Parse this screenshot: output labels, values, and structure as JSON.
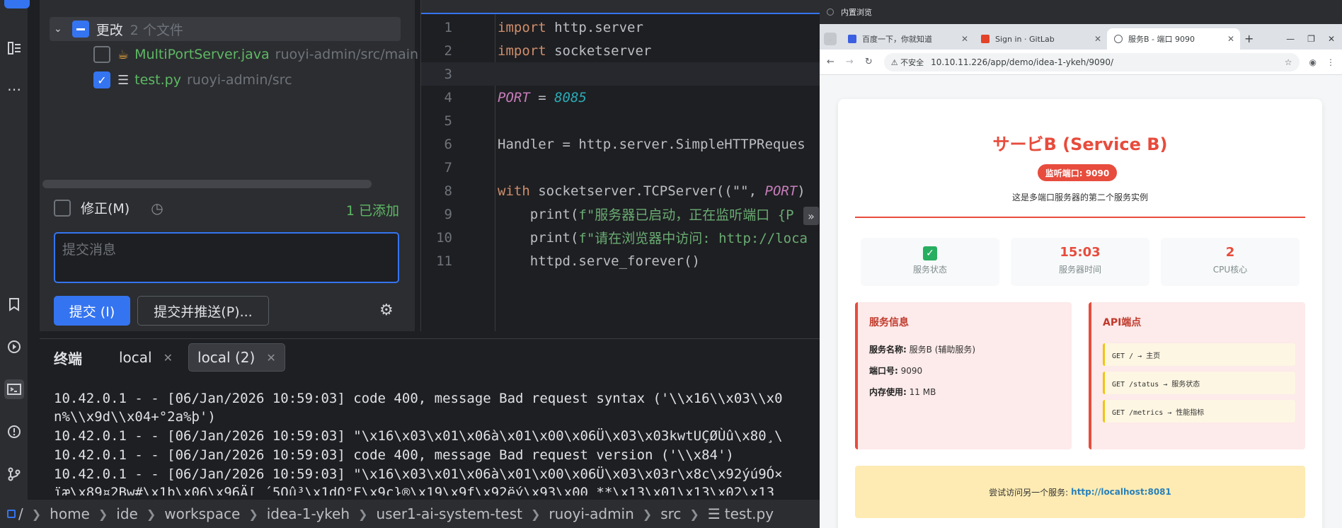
{
  "ide": {
    "commit": {
      "changes_label": "更改",
      "changes_count": "2 个文件",
      "files": [
        {
          "name": "MultiPortServer.java",
          "path": "ruoyi-admin/src/main",
          "checked": false
        },
        {
          "name": "test.py",
          "path": "ruoyi-admin/src",
          "checked": true
        }
      ],
      "amend_label": "修正(M)",
      "added_label": "1 已添加",
      "message_placeholder": "提交消息",
      "commit_button": "提交 (I)",
      "commit_push_button": "提交并推送(P)..."
    },
    "editor": {
      "lines": [
        {
          "n": "1",
          "tokens": [
            {
              "t": "import",
              "c": "kw"
            },
            {
              "t": " http.server",
              "c": "id"
            }
          ]
        },
        {
          "n": "2",
          "tokens": [
            {
              "t": "import",
              "c": "kw"
            },
            {
              "t": " socketserver",
              "c": "id"
            }
          ]
        },
        {
          "n": "3",
          "tokens": []
        },
        {
          "n": "4",
          "tokens": [
            {
              "t": "PORT",
              "c": "const"
            },
            {
              "t": " = ",
              "c": "id"
            },
            {
              "t": "8085",
              "c": "num"
            }
          ]
        },
        {
          "n": "5",
          "tokens": []
        },
        {
          "n": "6",
          "tokens": [
            {
              "t": "Handler = http.server.SimpleHTTPReques",
              "c": "id"
            }
          ]
        },
        {
          "n": "7",
          "tokens": []
        },
        {
          "n": "8",
          "tokens": [
            {
              "t": "with",
              "c": "kw"
            },
            {
              "t": " socketserver.TCPServer((\"\", ",
              "c": "id"
            },
            {
              "t": "PORT",
              "c": "const"
            },
            {
              "t": ")",
              "c": "id"
            }
          ]
        },
        {
          "n": "9",
          "tokens": [
            {
              "t": "    print(",
              "c": "id"
            },
            {
              "t": "f\"服务器已启动，正在监听端口 {P",
              "c": "str"
            }
          ]
        },
        {
          "n": "10",
          "tokens": [
            {
              "t": "    print(",
              "c": "id"
            },
            {
              "t": "f\"请在浏览器中访问: http://loca",
              "c": "str"
            }
          ]
        },
        {
          "n": "11",
          "tokens": [
            {
              "t": "    httpd.serve_forever()",
              "c": "id"
            }
          ]
        }
      ]
    },
    "terminal": {
      "title": "终端",
      "tabs": [
        {
          "label": "local"
        },
        {
          "label": "local (2)"
        }
      ],
      "lines": [
        "10.42.0.1 - - [06/Jan/2026 10:59:03] code 400, message Bad request syntax ('\\\\x16\\\\x03\\\\x0",
        "n%\\\\x9d\\\\x04+°2a%þ')",
        "10.42.0.1 - - [06/Jan/2026 10:59:03] \"\\x16\\x03\\x01\\x06à\\x01\\x00\\x06Ü\\x03\\x03kwtUÇØÙû\\x80¸\\",
        "10.42.0.1 - - [06/Jan/2026 10:59:03] code 400, message Bad request version ('\\\\x84')",
        "10.42.0.1 - - [06/Jan/2026 10:59:03] \"\\x16\\x03\\x01\\x06à\\x01\\x00\\x06Ü\\x03\\x03r\\x8c\\x92ýú9Ó×",
        "ïæ\\x89¤2Bw#\\x1b\\x06\\x96Ä[ ´5Oû³\\x1dO°F\\x9c}®\\x19\\x9f\\x92ëý\\x93\\x00 **\\x13\\x01\\x13\\x02\\x13"
      ]
    },
    "breadcrumb": [
      "/",
      "home",
      "ide",
      "workspace",
      "idea-1-ykeh",
      "user1-ai-system-test",
      "ruoyi-admin",
      "src",
      "test.py"
    ]
  },
  "browser": {
    "panel_title": "内置浏览",
    "tabs": [
      {
        "label": "百度一下，你就知道",
        "fav": "#3b5fe0"
      },
      {
        "label": "Sign in · GitLab",
        "fav": "#e24329"
      },
      {
        "label": "服务B - 端口 9090",
        "fav": "#5f6368"
      }
    ],
    "insecure_label": "不安全",
    "url": "10.10.11.226/app/demo/idea-1-ykeh/9090/",
    "page": {
      "title": "サービB (Service B)",
      "port_badge": "监听端口: 9090",
      "desc": "这是多端口服务器的第二个服务实例",
      "stats": [
        {
          "value": "",
          "label": "服务状态",
          "icon": "check-icon"
        },
        {
          "value": "15:03",
          "label": "服务器时间"
        },
        {
          "value": "2",
          "label": "CPU核心"
        }
      ],
      "service_info": {
        "heading": "服务信息",
        "rows": [
          {
            "k": "服务名称:",
            "v": "服务B (辅助服务)"
          },
          {
            "k": "端口号:",
            "v": "9090"
          },
          {
            "k": "内存使用:",
            "v": "11 MB"
          }
        ]
      },
      "api": {
        "heading": "API端点",
        "items": [
          "GET / → 主页",
          "GET /status → 服务状态",
          "GET /metrics → 性能指标"
        ]
      },
      "try_text": "尝试访问另一个服务:",
      "try_link": "http://localhost:8081"
    }
  }
}
